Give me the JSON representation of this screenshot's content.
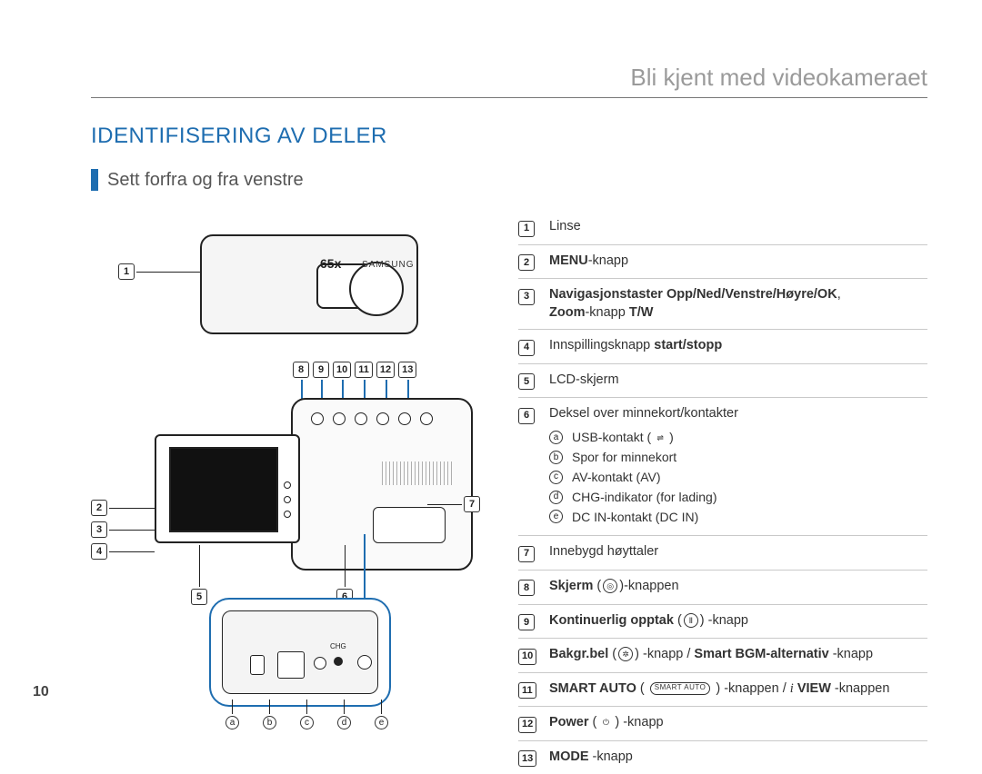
{
  "page_number": "10",
  "chapter_title": "Bli kjent med videokameraet",
  "section_title": "IDENTIFISERING AV DELER",
  "subsection_title": "Sett forfra og fra venstre",
  "figure": {
    "zoom_label": "65x",
    "brand": "SAMSUNG",
    "chg_label": "CHG"
  },
  "callouts_on_figure": {
    "front_left": [
      "1"
    ],
    "open_left": [
      "2",
      "3",
      "4"
    ],
    "open_bottom": [
      "5",
      "6"
    ],
    "open_right": [
      "7"
    ],
    "top_row": [
      "8",
      "9",
      "10",
      "11",
      "12",
      "13"
    ],
    "detail_letters": [
      "a",
      "b",
      "c",
      "d",
      "e"
    ]
  },
  "legend": [
    {
      "num": "1",
      "text": "Linse"
    },
    {
      "num": "2",
      "bold1": "MENU",
      "text": "-knapp"
    },
    {
      "num": "3",
      "bold1": "Navigasjonstaster Opp/Ned/Venstre/Høyre/OK",
      "mid": ", ",
      "bold2": "Zoom",
      "text2": "-knapp ",
      "bold3": "T/W"
    },
    {
      "num": "4",
      "pre": "Innspillingsknapp ",
      "bold1": "start/stopp"
    },
    {
      "num": "5",
      "text": "LCD-skjerm"
    },
    {
      "num": "6",
      "text": "Deksel over minnekort/kontakter",
      "sub": [
        {
          "letter": "a",
          "label": "USB-kontakt (",
          "icon": "usb-icon",
          "glyph": "⇌",
          "tail": ")"
        },
        {
          "letter": "b",
          "label": "Spor for minnekort"
        },
        {
          "letter": "c",
          "label": "AV-kontakt (AV)"
        },
        {
          "letter": "d",
          "label": "CHG-indikator (for lading)"
        },
        {
          "letter": "e",
          "label": "DC IN-kontakt (DC IN)"
        }
      ]
    },
    {
      "num": "7",
      "text": "Innebygd høyttaler"
    },
    {
      "num": "8",
      "bold1": "Skjerm",
      "mid": " (",
      "icon": "display-icon",
      "glyph": "◎",
      "text2": ")-knappen"
    },
    {
      "num": "9",
      "bold1": "Kontinuerlig opptak",
      "mid": " (",
      "icon": "pause-icon",
      "glyph": "Ⅱ",
      "text2": ") -knapp"
    },
    {
      "num": "10",
      "bold1": "Bakgr.bel",
      "mid": " (",
      "icon": "backlight-icon",
      "glyph": "✲",
      "text2": ") -knapp / ",
      "bold2": "Smart BGM-alternativ",
      "tail": " -knapp"
    },
    {
      "num": "11",
      "bold1": "SMART AUTO",
      "mid": " ( ",
      "pill": "SMART AUTO",
      "text2": " ) -knappen / ",
      "italic": "i",
      "bold2": " VIEW",
      "tail": " -knappen"
    },
    {
      "num": "12",
      "bold1": "Power",
      "mid": " (",
      "icon": "power-icon",
      "glyph": "⏻",
      "text2": ") -knapp"
    },
    {
      "num": "13",
      "bold1": "MODE",
      "text": " -knapp"
    }
  ]
}
